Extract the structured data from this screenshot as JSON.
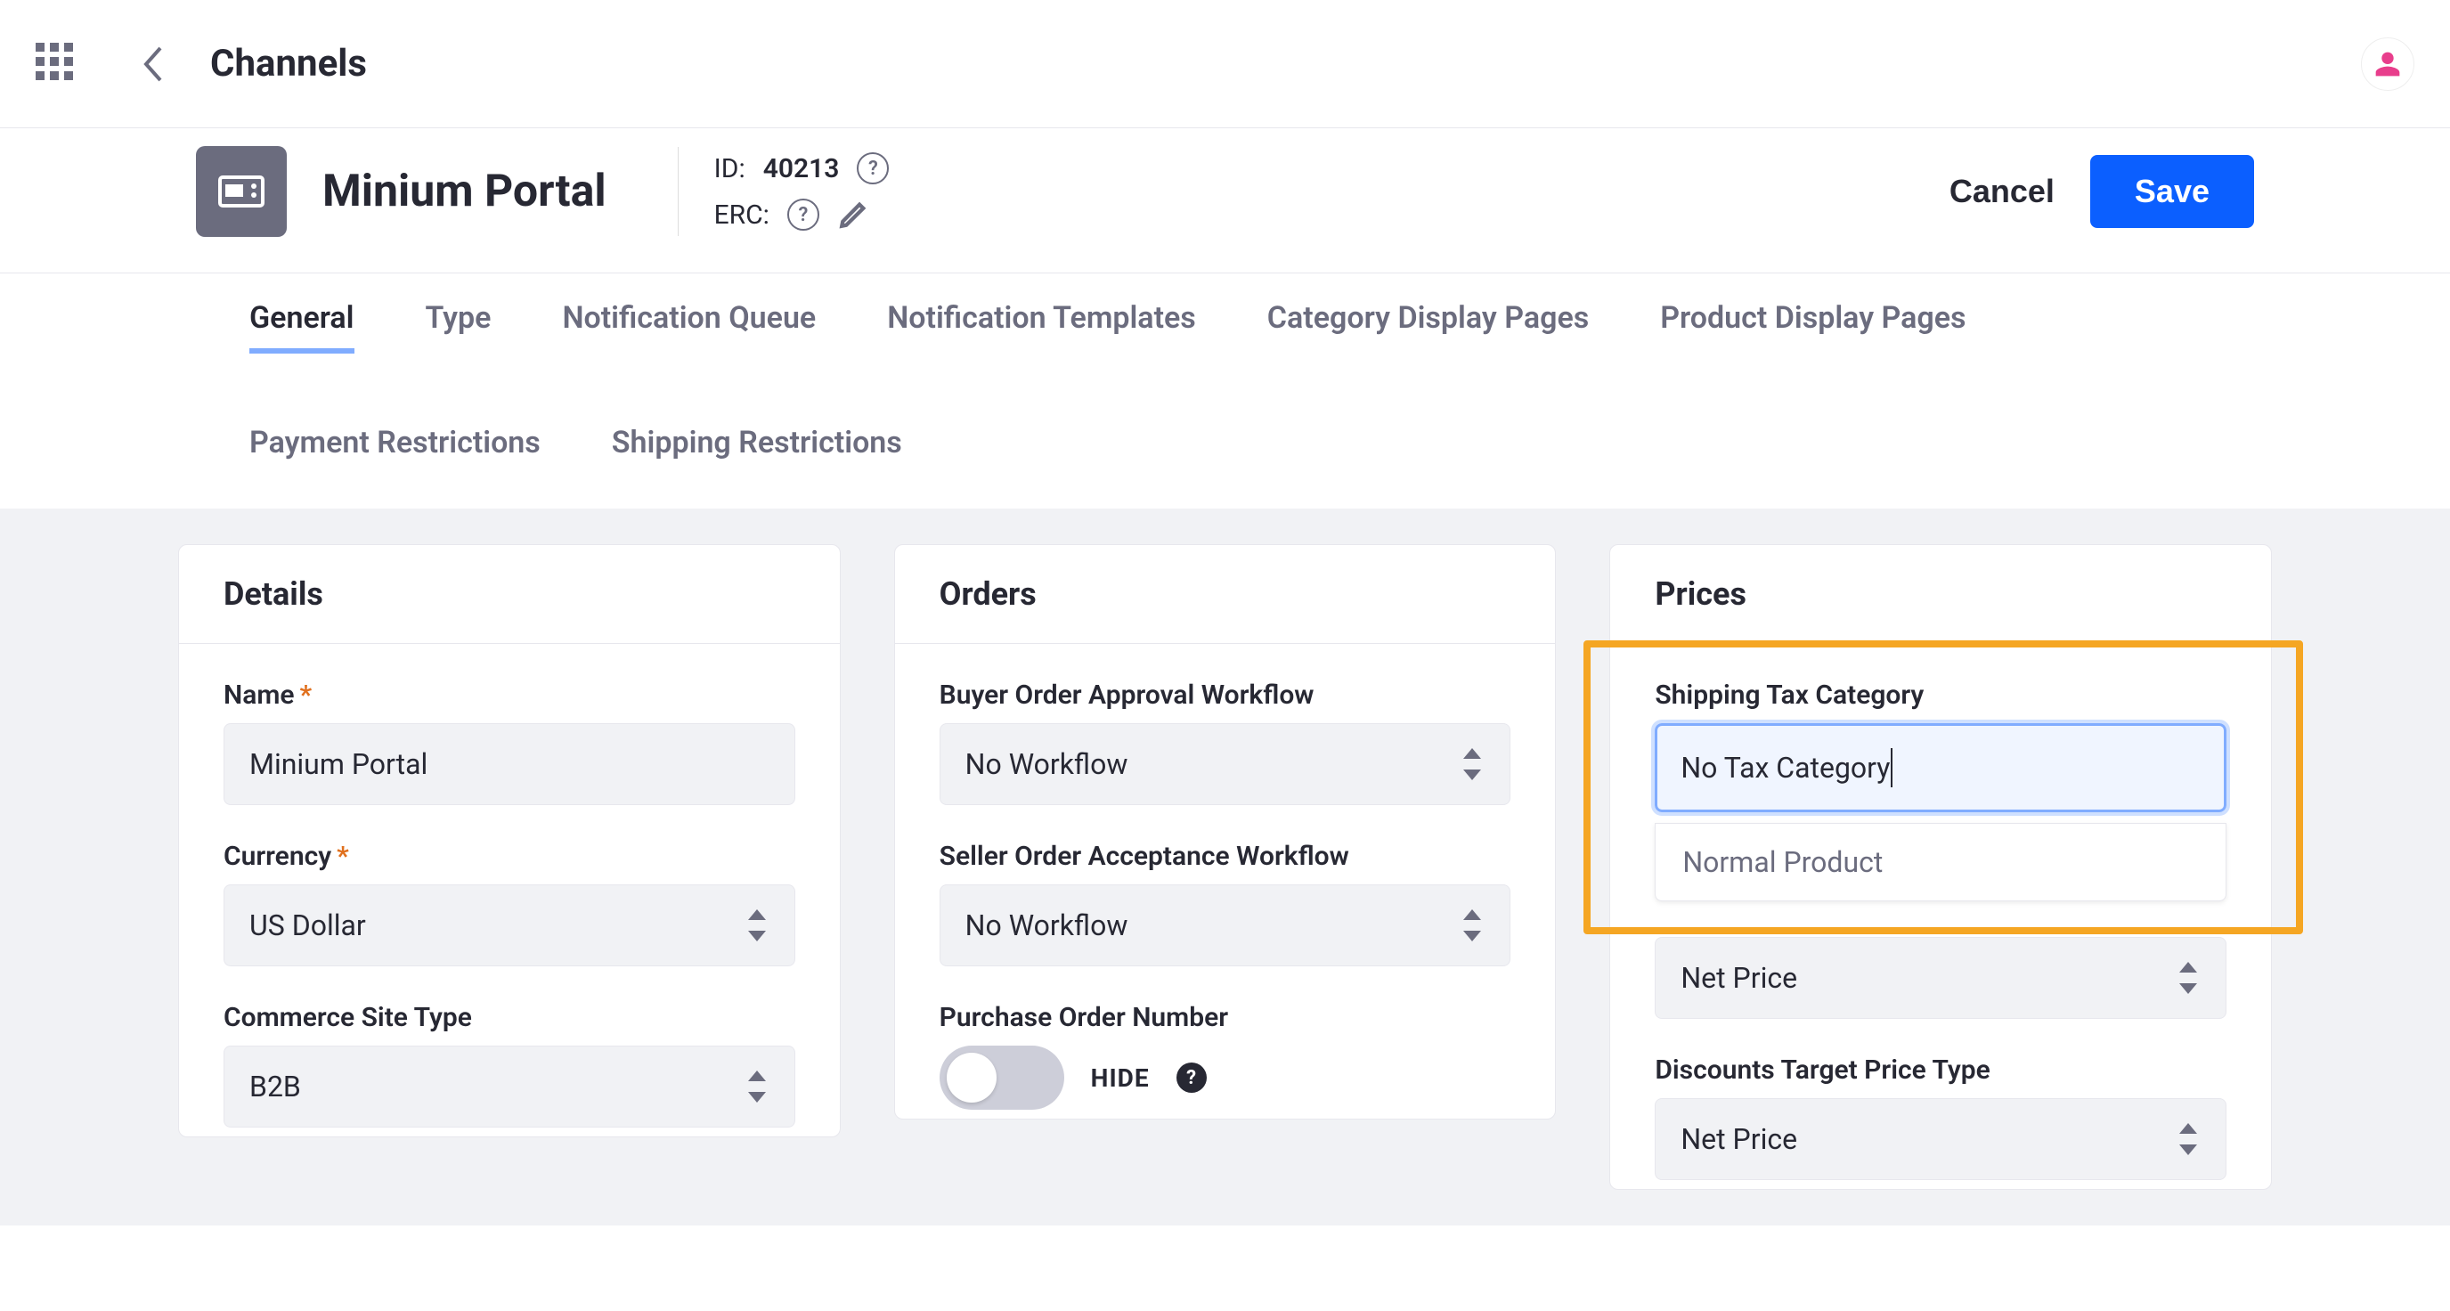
{
  "topbar": {
    "title": "Channels"
  },
  "header": {
    "title": "Minium Portal",
    "id_label": "ID:",
    "id_value": "40213",
    "erc_label": "ERC:",
    "cancel": "Cancel",
    "save": "Save"
  },
  "tabs": {
    "row": [
      "General",
      "Type",
      "Notification Queue",
      "Notification Templates",
      "Category Display Pages",
      "Product Display Pages",
      "Payment Restrictions",
      "Shipping Restrictions"
    ],
    "active": "General"
  },
  "details": {
    "title": "Details",
    "name_label": "Name",
    "name_value": "Minium Portal",
    "currency_label": "Currency",
    "currency_value": "US Dollar",
    "site_type_label": "Commerce Site Type",
    "site_type_value": "B2B"
  },
  "orders": {
    "title": "Orders",
    "buyer_label": "Buyer Order Approval Workflow",
    "buyer_value": "No Workflow",
    "seller_label": "Seller Order Acceptance Workflow",
    "seller_value": "No Workflow",
    "po_label": "Purchase Order Number",
    "po_toggle_text": "HIDE"
  },
  "prices": {
    "title": "Prices",
    "ship_tax_label": "Shipping Tax Category",
    "ship_tax_value": "No Tax Category",
    "ship_tax_option": "Normal Product",
    "price_type_value": "Net Price",
    "discounts_label": "Discounts Target Price Type",
    "discounts_value": "Net Price"
  }
}
